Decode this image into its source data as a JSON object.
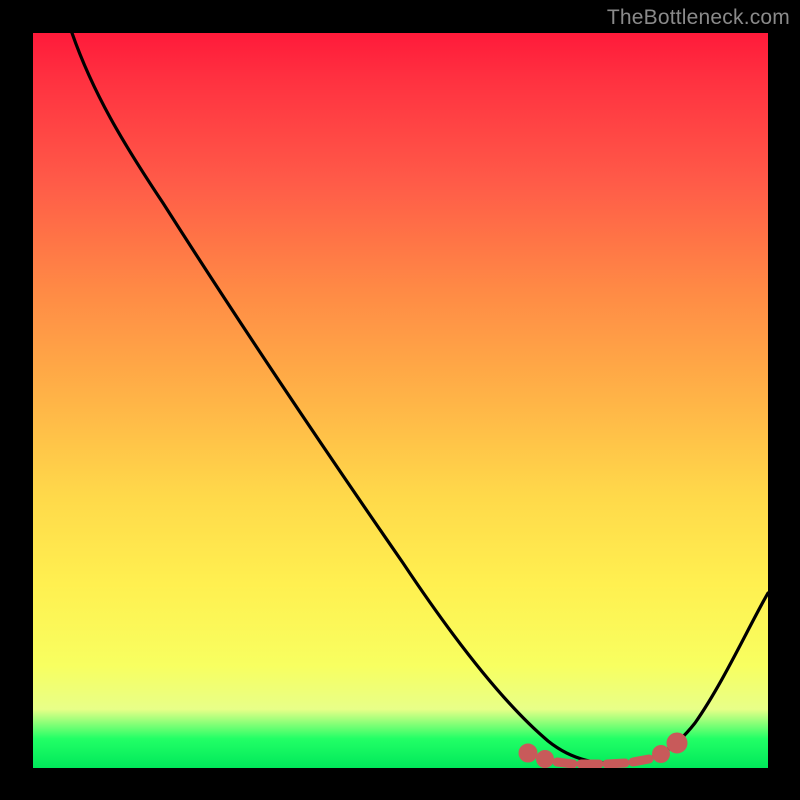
{
  "watermark": "TheBottleneck.com",
  "chart_data": {
    "type": "line",
    "title": "",
    "xlabel": "",
    "ylabel": "",
    "xlim": [
      0,
      100
    ],
    "ylim": [
      0,
      100
    ],
    "x": [
      0,
      6,
      12,
      18,
      24,
      30,
      36,
      42,
      48,
      54,
      60,
      64,
      68,
      72,
      76,
      80,
      84,
      88,
      92,
      96,
      100
    ],
    "values": [
      100,
      93,
      85,
      77,
      68,
      59,
      50,
      41,
      33,
      25,
      17,
      11,
      6,
      3,
      1,
      0,
      0,
      1,
      5,
      12,
      22
    ],
    "optimal_band_x": [
      64,
      86
    ],
    "markers": [
      {
        "x": 64,
        "y": 2
      },
      {
        "x": 68,
        "y": 1
      },
      {
        "x": 72,
        "y": 0.5
      },
      {
        "x": 76,
        "y": 0.3
      },
      {
        "x": 80,
        "y": 0.5
      },
      {
        "x": 84,
        "y": 1
      },
      {
        "x": 86,
        "y": 2
      }
    ],
    "gradient_stops": [
      {
        "pos": 0,
        "color": "#ff1a3a"
      },
      {
        "pos": 50,
        "color": "#ffb447"
      },
      {
        "pos": 80,
        "color": "#f8ff60"
      },
      {
        "pos": 100,
        "color": "#00e85a"
      }
    ]
  }
}
